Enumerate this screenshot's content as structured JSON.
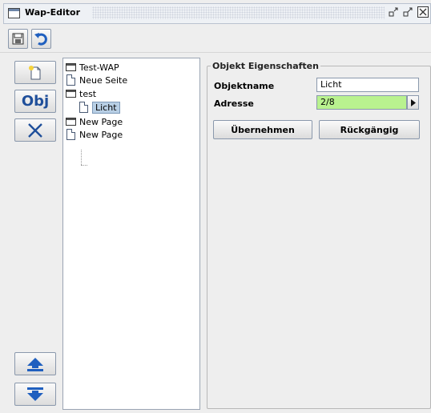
{
  "window": {
    "title": "Wap-Editor"
  },
  "toolbar": {
    "save_icon": "floppy-icon",
    "undo_icon": "undo-icon"
  },
  "side_buttons": {
    "new_page_icon": "new-page-icon",
    "obj_label": "Obj",
    "delete_icon": "delete-x-icon",
    "move_up_icon": "arrow-up-icon",
    "move_down_icon": "arrow-down-icon"
  },
  "tree": {
    "items": [
      {
        "label": "Test-WAP",
        "type": "folder",
        "level": 0
      },
      {
        "label": "Neue Seite",
        "type": "page",
        "level": 0
      },
      {
        "label": "test",
        "type": "folder",
        "level": 0
      },
      {
        "label": "Licht",
        "type": "page",
        "level": 1,
        "selected": true
      },
      {
        "label": "New Page",
        "type": "folder",
        "level": 0
      },
      {
        "label": "New Page",
        "type": "page",
        "level": 0
      }
    ]
  },
  "properties": {
    "group_title": "Objekt Eigenschaften",
    "name_label": "Objektname",
    "name_value": "Licht",
    "address_label": "Adresse",
    "address_value": "2/8",
    "apply_label": "Übernehmen",
    "revert_label": "Rückgängig"
  },
  "colors": {
    "address_field_bg": "#b9f28f",
    "selection_bg": "#b8cfe5",
    "obj_text": "#1f4f9a",
    "delete_x": "#1f4f9a",
    "arrows": "#1f5fbf"
  }
}
